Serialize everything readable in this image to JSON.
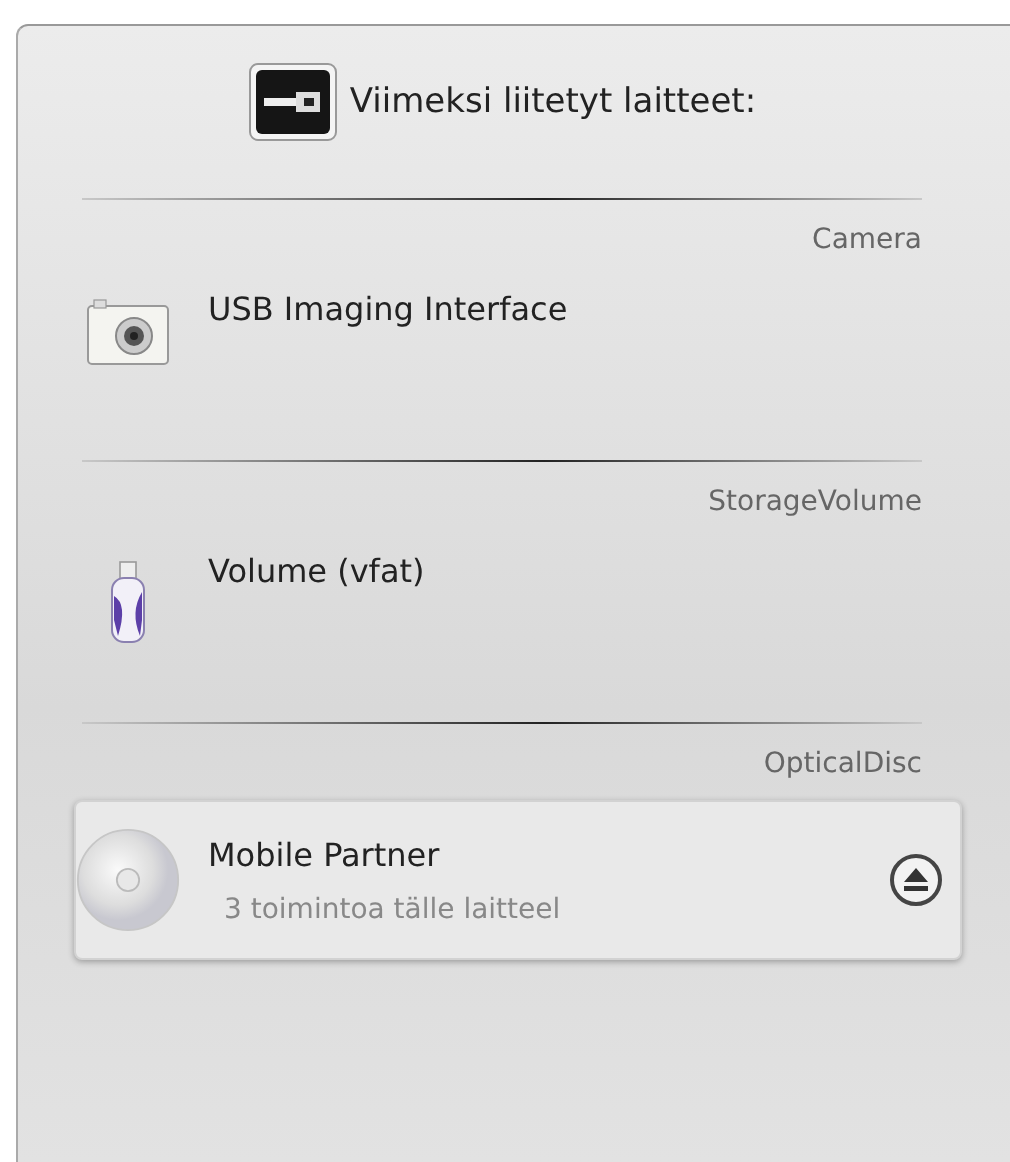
{
  "header": {
    "title": "Viimeksi liitetyt laitteet:"
  },
  "devices": [
    {
      "category": "Camera",
      "name": "USB Imaging Interface",
      "kind": "camera",
      "highlighted": false
    },
    {
      "category": "StorageVolume",
      "name": "Volume (vfat)",
      "kind": "usb",
      "highlighted": false
    },
    {
      "category": "OpticalDisc",
      "name": "Mobile Partner",
      "kind": "disc",
      "highlighted": true,
      "actions": "3 toimintoa tälle laitteel",
      "eject": true
    }
  ]
}
